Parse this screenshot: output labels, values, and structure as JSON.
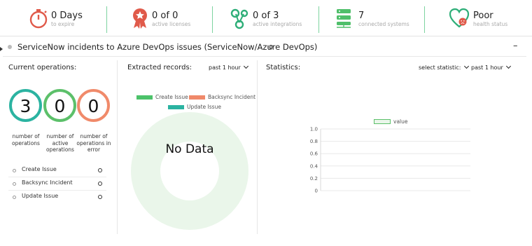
{
  "topbar": {
    "stats": [
      {
        "value": "0 Days",
        "label": "to expire",
        "icon": "stopwatch-icon"
      },
      {
        "value": "0 of 0",
        "label": "active licenses",
        "icon": "award-icon"
      },
      {
        "value": "0 of 3",
        "label": "active integrations",
        "icon": "integrations-icon"
      },
      {
        "value": "7",
        "label": "connected systems",
        "icon": "server-icon"
      },
      {
        "value": "Poor",
        "label": "health status",
        "icon": "heart-sad-icon"
      }
    ]
  },
  "panel": {
    "title": "ServiceNow incidents to Azure DevOps issues (ServiceNow/Azure DevOps)",
    "minimize": "–"
  },
  "current_operations": {
    "title": "Current operations:",
    "counters": [
      {
        "value": "3",
        "label": "number of operations",
        "color": "#2bb3a1"
      },
      {
        "value": "0",
        "label": "number of active operations",
        "color": "#5cc06a"
      },
      {
        "value": "0",
        "label": "number of operations in error",
        "color": "#f08a6a"
      }
    ],
    "operations": [
      "Create Issue",
      "Backsync Incident",
      "Update Issue"
    ]
  },
  "extracted_records": {
    "title": "Extracted records:",
    "period": "past 1 hour",
    "legend": [
      {
        "label": "Create Issue",
        "color": "#4cc26a"
      },
      {
        "label": "Backsync Incident",
        "color": "#f0896a"
      },
      {
        "label": "Update Issue",
        "color": "#2bb3a1"
      }
    ],
    "empty_text": "No Data"
  },
  "statistics": {
    "title": "Statistics:",
    "select_label": "select statistic:",
    "period": "past 1 hour",
    "legend_label": "value"
  },
  "chart_data": {
    "type": "bar",
    "series": [
      {
        "name": "value",
        "values": []
      }
    ],
    "categories": [],
    "ylim": [
      0,
      1.0
    ],
    "yticks": [
      "1.0",
      "0.8",
      "0.6",
      "0.4",
      "0.2",
      "0"
    ],
    "legend_position": "top-center",
    "grid": true
  }
}
